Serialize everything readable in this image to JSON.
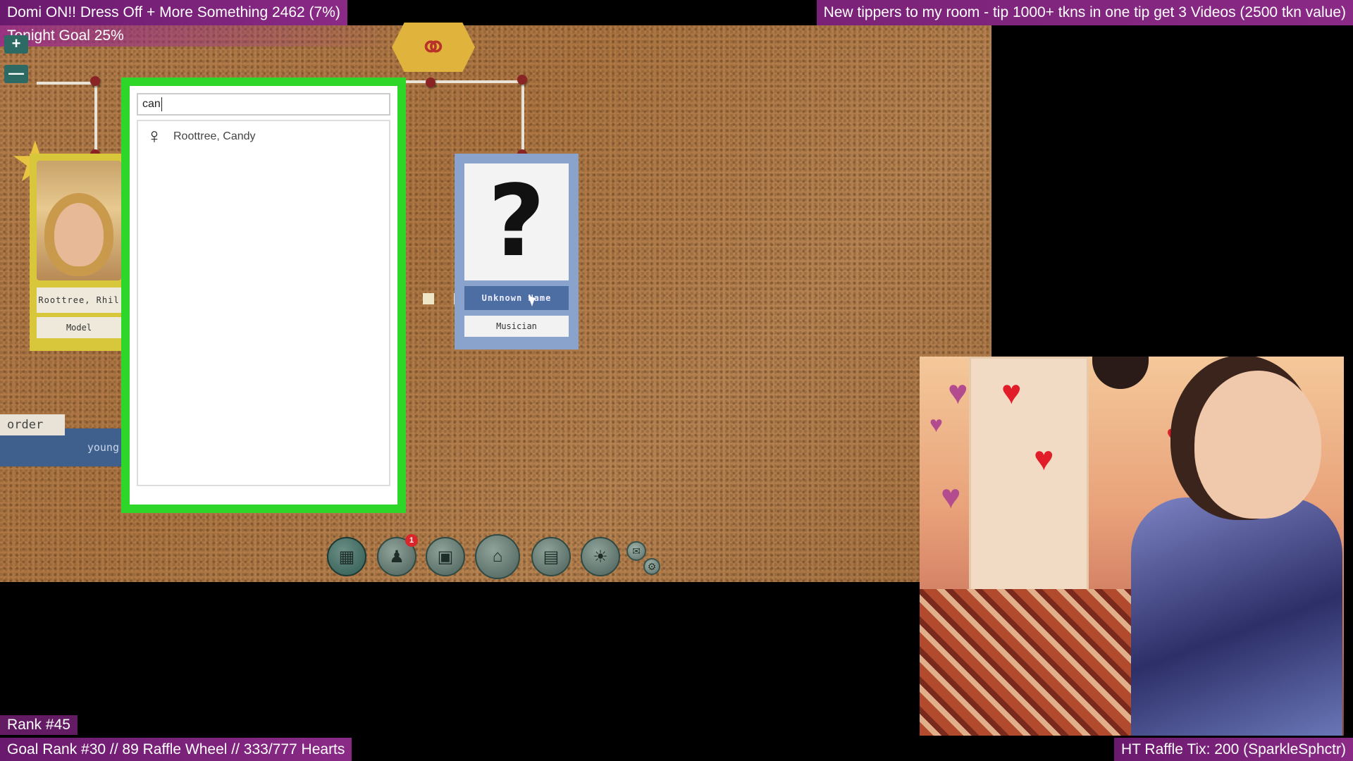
{
  "overlay": {
    "top_left": "Domi ON!! Dress Off + More Something  2462 (7%)",
    "top_right": "New tippers to my room - tip 1000+ tkns in one tip get 3 Videos (2500 tkn value)",
    "goal": "Tonight Goal 25%",
    "rank": "Rank #45",
    "goal_rank": "Goal Rank #30 // 89 Raffle Wheel // 333/777 Hearts",
    "raffle": "HT Raffle Tix: 200 (SparkleSphctr)"
  },
  "zoom": {
    "in_label": "+",
    "out_label": "—"
  },
  "board": {
    "rings_icon": "rings-icon",
    "left_card": {
      "name": "Roottree, Rhil",
      "role": "Model"
    },
    "left_tags": {
      "order": "order",
      "young": "young"
    },
    "unknown_card": {
      "symbol": "?",
      "name": "Unknown Name",
      "role": "Musician"
    }
  },
  "search": {
    "value": "can",
    "results": [
      {
        "gender_icon": "female-icon",
        "name": "Roottree, Candy"
      }
    ]
  },
  "toolbar": {
    "items": [
      {
        "icon": "corkboard-icon",
        "active": true
      },
      {
        "icon": "contacts-icon",
        "badge": "1"
      },
      {
        "icon": "computer-icon"
      },
      {
        "icon": "home-icon"
      },
      {
        "icon": "notebook-icon"
      },
      {
        "icon": "idea-icon"
      },
      {
        "icon": "chat-icon"
      },
      {
        "icon": "settings-icon"
      }
    ]
  },
  "colors": {
    "search_frame": "#2fd62a",
    "overlay_purple": "#8a2a86",
    "unknown_card": "#8aa3cc",
    "left_card": "#d8c73a"
  }
}
